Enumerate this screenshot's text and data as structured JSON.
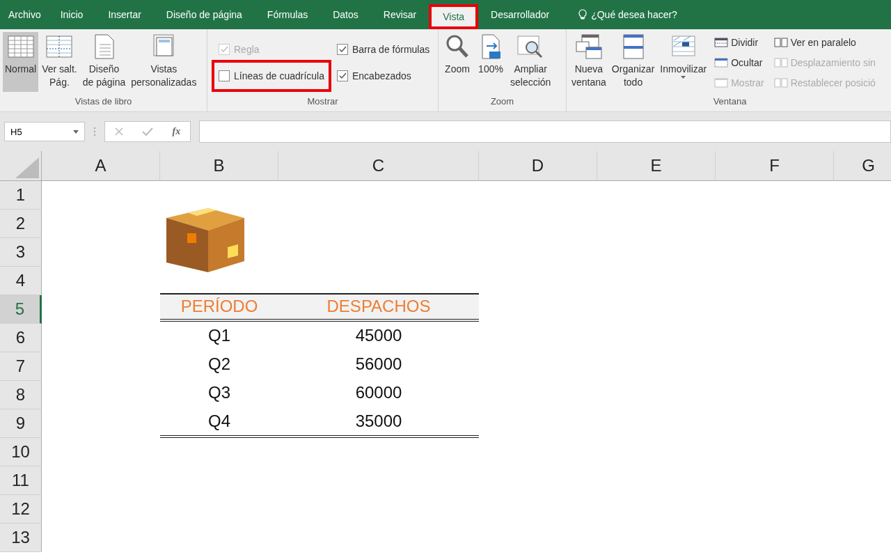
{
  "tabs": [
    {
      "label": "Archivo",
      "selected": false,
      "highlighted": false
    },
    {
      "label": "Inicio",
      "selected": false,
      "highlighted": false
    },
    {
      "label": "Insertar",
      "selected": false,
      "highlighted": false
    },
    {
      "label": "Diseño de página",
      "selected": false,
      "highlighted": false
    },
    {
      "label": "Fórmulas",
      "selected": false,
      "highlighted": false
    },
    {
      "label": "Datos",
      "selected": false,
      "highlighted": false
    },
    {
      "label": "Revisar",
      "selected": false,
      "highlighted": false
    },
    {
      "label": "Vista",
      "selected": true,
      "highlighted": true
    },
    {
      "label": "Desarrollador",
      "selected": false,
      "highlighted": false
    }
  ],
  "tell_me": "¿Qué desea hacer?",
  "groups": [
    {
      "kind": "buttons",
      "label": "Vistas de libro",
      "buttons": [
        {
          "label": "Normal",
          "kind": "normal",
          "selected": true,
          "dropdown": false
        },
        {
          "label": "Ver salt.\nPág.",
          "kind": "pagebreak",
          "selected": false,
          "dropdown": false
        },
        {
          "label": "Diseño\nde página",
          "kind": "page",
          "selected": false,
          "dropdown": false
        },
        {
          "label": "Vistas\npersonalizadas",
          "kind": "custom",
          "selected": false,
          "dropdown": false
        }
      ]
    },
    {
      "kind": "checks",
      "label": "Mostrar",
      "checks": [
        {
          "label": "Regla",
          "checked": true,
          "disabled": true,
          "highlighted": false
        },
        {
          "label": "Líneas de cuadrícula",
          "checked": false,
          "disabled": false,
          "highlighted": true
        },
        {
          "label": "Barra de fórmulas",
          "checked": true,
          "disabled": false,
          "highlighted": false
        },
        {
          "label": "Encabezados",
          "checked": true,
          "disabled": false,
          "highlighted": false
        }
      ]
    },
    {
      "kind": "buttons",
      "label": "Zoom",
      "buttons": [
        {
          "label": "Zoom",
          "kind": "zoom",
          "selected": false,
          "dropdown": false
        },
        {
          "label": "100%",
          "kind": "hundred",
          "selected": false,
          "dropdown": false
        },
        {
          "label": "Ampliar\nselección",
          "kind": "zoomsel",
          "selected": false,
          "dropdown": false
        }
      ]
    },
    {
      "kind": "window",
      "label": "Ventana",
      "buttons": [
        {
          "label": "Nueva\nventana",
          "kind": "newwin",
          "selected": false,
          "dropdown": false
        },
        {
          "label": "Organizar\ntodo",
          "kind": "arrange",
          "selected": false,
          "dropdown": false
        },
        {
          "label": "Inmovilizar",
          "kind": "freeze",
          "selected": false,
          "dropdown": true
        }
      ],
      "small": [
        {
          "label": "Dividir",
          "kind": "split",
          "disabled": false
        },
        {
          "label": "Ocultar",
          "kind": "hide",
          "disabled": false
        },
        {
          "label": "Mostrar",
          "kind": "show",
          "disabled": true
        },
        {
          "label": "Ver en paralelo",
          "kind": "side",
          "disabled": false
        },
        {
          "label": "Desplazamiento sin",
          "kind": "sync",
          "disabled": true
        },
        {
          "label": "Restablecer posició",
          "kind": "reset",
          "disabled": true
        }
      ]
    }
  ],
  "formula_bar": {
    "name_box": "H5",
    "fx": "fx"
  },
  "columns": [
    {
      "label": "A"
    },
    {
      "label": "B"
    },
    {
      "label": "C"
    },
    {
      "label": "D"
    },
    {
      "label": "E"
    },
    {
      "label": "F"
    },
    {
      "label": "G"
    }
  ],
  "rows": [
    {
      "label": "1",
      "selected": false
    },
    {
      "label": "2",
      "selected": false
    },
    {
      "label": "3",
      "selected": false
    },
    {
      "label": "4",
      "selected": false
    },
    {
      "label": "5",
      "selected": true
    },
    {
      "label": "6",
      "selected": false
    },
    {
      "label": "7",
      "selected": false
    },
    {
      "label": "8",
      "selected": false
    },
    {
      "label": "9",
      "selected": false
    },
    {
      "label": "10",
      "selected": false
    },
    {
      "label": "11",
      "selected": false
    },
    {
      "label": "12",
      "selected": false
    },
    {
      "label": "13",
      "selected": false
    }
  ],
  "table": {
    "columns": [
      "PERÍODO",
      "DESPACHOS"
    ],
    "rows": [
      [
        "Q1",
        "45000"
      ],
      [
        "Q2",
        "56000"
      ],
      [
        "Q3",
        "60000"
      ],
      [
        "Q4",
        "35000"
      ]
    ]
  }
}
